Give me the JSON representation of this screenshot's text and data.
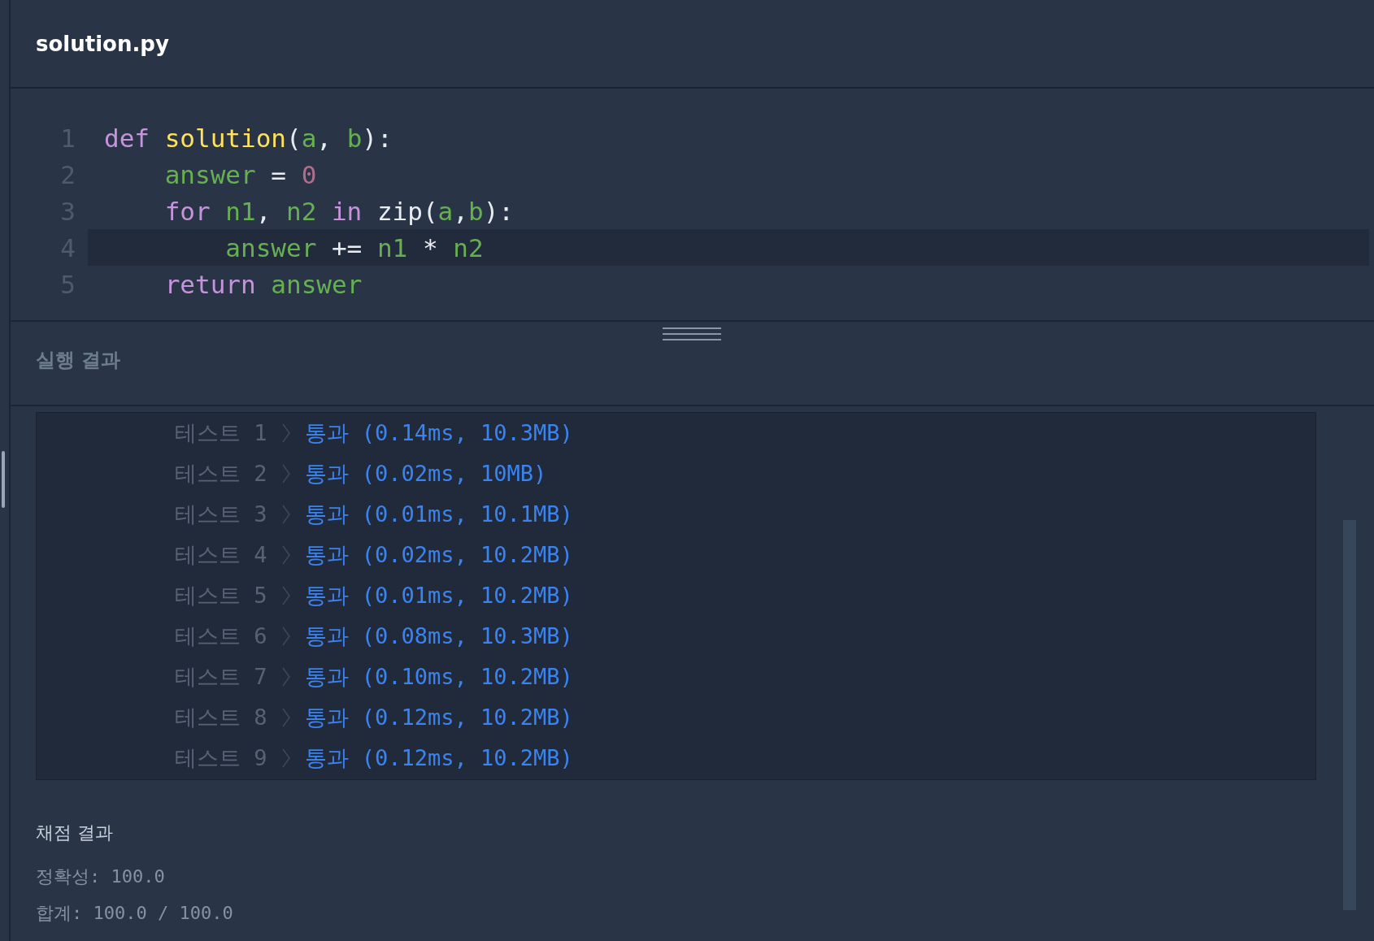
{
  "editor": {
    "filename": "solution.py",
    "lines": [
      {
        "number": "1",
        "current": false,
        "tokens": [
          {
            "kind": "keyword",
            "text": "def "
          },
          {
            "kind": "function",
            "text": "solution"
          },
          {
            "kind": "plain",
            "text": "("
          },
          {
            "kind": "variable",
            "text": "a"
          },
          {
            "kind": "plain",
            "text": ", "
          },
          {
            "kind": "variable",
            "text": "b"
          },
          {
            "kind": "plain",
            "text": "):"
          }
        ]
      },
      {
        "number": "2",
        "current": false,
        "tokens": [
          {
            "kind": "variable",
            "text": "    answer"
          },
          {
            "kind": "plain",
            "text": " = "
          },
          {
            "kind": "number",
            "text": "0"
          }
        ]
      },
      {
        "number": "3",
        "current": false,
        "tokens": [
          {
            "kind": "keyword",
            "text": "    for "
          },
          {
            "kind": "variable",
            "text": "n1"
          },
          {
            "kind": "plain",
            "text": ", "
          },
          {
            "kind": "variable",
            "text": "n2"
          },
          {
            "kind": "keyword",
            "text": " in "
          },
          {
            "kind": "plain",
            "text": "zip("
          },
          {
            "kind": "variable",
            "text": "a"
          },
          {
            "kind": "plain",
            "text": ","
          },
          {
            "kind": "variable",
            "text": "b"
          },
          {
            "kind": "plain",
            "text": "):"
          }
        ]
      },
      {
        "number": "4",
        "current": true,
        "tokens": [
          {
            "kind": "variable",
            "text": "        answer"
          },
          {
            "kind": "plain",
            "text": " += "
          },
          {
            "kind": "variable",
            "text": "n1"
          },
          {
            "kind": "plain",
            "text": " * "
          },
          {
            "kind": "variable",
            "text": "n2"
          }
        ]
      },
      {
        "number": "5",
        "current": false,
        "tokens": [
          {
            "kind": "keyword",
            "text": "    return "
          },
          {
            "kind": "variable",
            "text": "answer"
          }
        ]
      }
    ]
  },
  "run_results": {
    "title": "실행 결과",
    "tests": [
      {
        "label": "테스트 1",
        "passed": true,
        "result": "통과 (0.14ms, 10.3MB)"
      },
      {
        "label": "테스트 2",
        "passed": true,
        "result": "통과 (0.02ms, 10MB)"
      },
      {
        "label": "테스트 3",
        "passed": true,
        "result": "통과 (0.01ms, 10.1MB)"
      },
      {
        "label": "테스트 4",
        "passed": true,
        "result": "통과 (0.02ms, 10.2MB)"
      },
      {
        "label": "테스트 5",
        "passed": true,
        "result": "통과 (0.01ms, 10.2MB)"
      },
      {
        "label": "테스트 6",
        "passed": true,
        "result": "통과 (0.08ms, 10.3MB)"
      },
      {
        "label": "테스트 7",
        "passed": true,
        "result": "통과 (0.10ms, 10.2MB)"
      },
      {
        "label": "테스트 8",
        "passed": true,
        "result": "통과 (0.12ms, 10.2MB)"
      },
      {
        "label": "테스트 9",
        "passed": true,
        "result": "통과 (0.12ms, 10.2MB)"
      }
    ],
    "grading": {
      "title": "채점 결과",
      "lines": [
        "정확성: 100.0",
        "합계: 100.0 / 100.0"
      ]
    }
  }
}
